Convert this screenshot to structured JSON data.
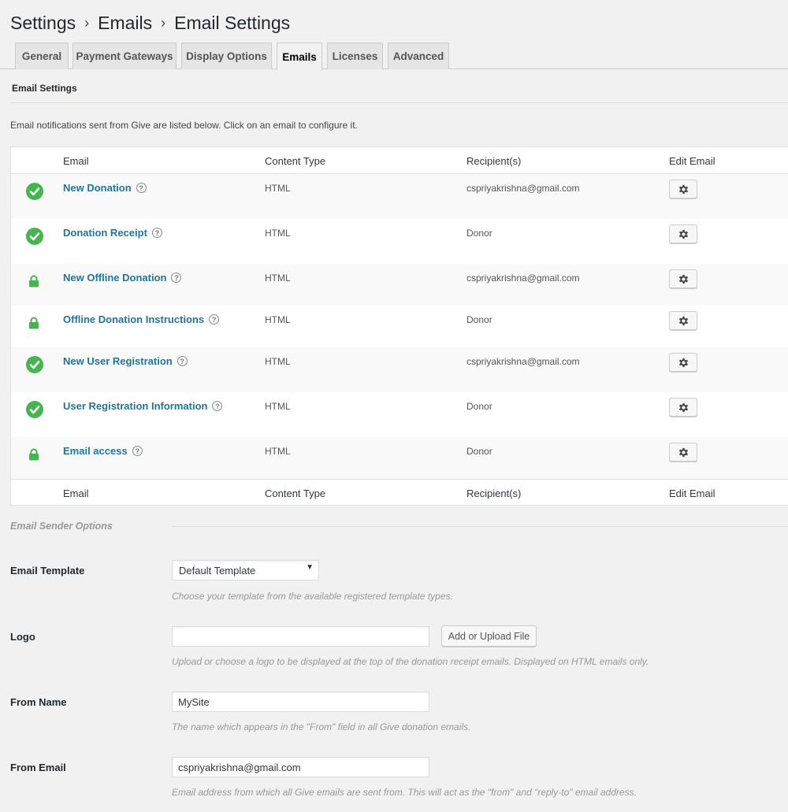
{
  "breadcrumb": {
    "items": [
      "Settings",
      "Emails",
      "Email Settings"
    ],
    "separator": "›"
  },
  "tabs": [
    {
      "label": "General",
      "active": false
    },
    {
      "label": "Payment Gateways",
      "active": false
    },
    {
      "label": "Display Options",
      "active": false
    },
    {
      "label": "Emails",
      "active": true
    },
    {
      "label": "Licenses",
      "active": false
    },
    {
      "label": "Advanced",
      "active": false
    }
  ],
  "section_title": "Email Settings",
  "intro_text": "Email notifications sent from Give are listed below. Click on an email to configure it.",
  "table": {
    "headers": [
      "Email",
      "Content Type",
      "Recipient(s)",
      "Edit Email"
    ],
    "rows": [
      {
        "status": "enabled",
        "status_icon": "check-circle-icon",
        "email": "New Donation",
        "content_type": "HTML",
        "recipients": "cspriyakrishna@gmail.com"
      },
      {
        "status": "enabled",
        "status_icon": "check-circle-icon",
        "email": "Donation Receipt",
        "content_type": "HTML",
        "recipients": "Donor"
      },
      {
        "status": "locked",
        "status_icon": "lock-icon",
        "email": "New Offline Donation",
        "content_type": "HTML",
        "recipients": "cspriyakrishna@gmail.com"
      },
      {
        "status": "locked",
        "status_icon": "lock-icon",
        "email": "Offline Donation Instructions",
        "content_type": "HTML",
        "recipients": "Donor"
      },
      {
        "status": "enabled",
        "status_icon": "check-circle-icon",
        "email": "New User Registration",
        "content_type": "HTML",
        "recipients": "cspriyakrishna@gmail.com"
      },
      {
        "status": "enabled",
        "status_icon": "check-circle-icon",
        "email": "User Registration Information",
        "content_type": "HTML",
        "recipients": "Donor"
      },
      {
        "status": "locked",
        "status_icon": "lock-icon",
        "email": "Email access",
        "content_type": "HTML",
        "recipients": "Donor"
      }
    ]
  },
  "sender_options": {
    "title": "Email Sender Options",
    "email_template": {
      "label": "Email Template",
      "value": "Default Template",
      "description": "Choose your template from the available registered template types."
    },
    "logo": {
      "label": "Logo",
      "value": "",
      "button_label": "Add or Upload File",
      "description": "Upload or choose a logo to be displayed at the top of the donation receipt emails. Displayed on HTML emails only."
    },
    "from_name": {
      "label": "From Name",
      "value": "MySite",
      "description": "The name which appears in the \"From\" field in all Give donation emails."
    },
    "from_email": {
      "label": "From Email",
      "value": "cspriyakrishna@gmail.com",
      "description": "Email address from which all Give emails are sent from. This will act as the \"from\" and \"reply-to\" email address."
    }
  },
  "colors": {
    "link": "#21759b",
    "enabled_green": "#46b450",
    "locked_green": "#46b450",
    "page_bg": "#f1f1f1"
  }
}
